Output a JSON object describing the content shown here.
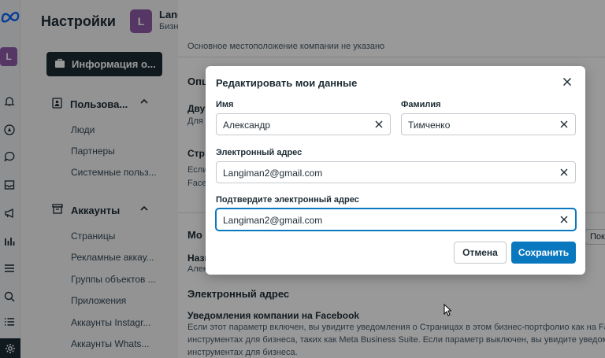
{
  "header": {
    "app_title": "Настройки",
    "business_initial": "L",
    "business_name": "Langust",
    "business_subtitle": "Бизнес-портфолио"
  },
  "rail": {
    "avatar_initial": "L",
    "icons": [
      "bell-icon",
      "compass-icon",
      "chat-icon",
      "inbox-icon",
      "megaphone-icon",
      "bar-chart-icon",
      "menu-icon",
      "search-icon",
      "list-icon",
      "gear-icon"
    ]
  },
  "sidebar": {
    "active_label": "Информация о...",
    "users_section": "Пользова...",
    "users_items": [
      "Люди",
      "Партнеры",
      "Системные польз..."
    ],
    "accounts_section": "Аккаунты",
    "accounts_items": [
      "Страницы",
      "Рекламные аккау...",
      "Группы объектов ...",
      "Приложения",
      "Аккаунты Instagr...",
      "Аккаунты Whats..."
    ]
  },
  "background": {
    "line1": "Основное местоположение компании не указано",
    "opt_heading": "Опц",
    "two_fa": "Дву",
    "for_label": "Для",
    "str": "Стр",
    "if_label": "Если",
    "face": "Face",
    "mo": "Мо",
    "name_label": "Назв",
    "alex": "Алек",
    "show_more": "Пока",
    "email_heading": "Электронный адрес",
    "notifications_heading": "Уведомления компании на Facebook",
    "notifications_line1": "Если этот параметр включен, вы увидите уведомления о Страницах в этом бизнес-портфолио как на Fa",
    "notifications_line2": "инструментах для бизнеса, таких как Meta Business Suite. Если параметр выключен, вы увидите уведом",
    "notifications_line3": "инструментах для бизнеса."
  },
  "modal": {
    "title": "Редактировать мои данные",
    "first_name_label": "Имя",
    "first_name_value": "Александр",
    "last_name_label": "Фамилия",
    "last_name_value": "Тимченко",
    "email_label": "Электронный адрес",
    "email_value": "Langiman2@gmail.com",
    "confirm_email_label": "Подтвердите электронный адрес",
    "confirm_email_value": "Langiman2@gmail.com",
    "cancel_label": "Отмена",
    "save_label": "Сохранить"
  },
  "colors": {
    "primary": "#0a78be",
    "dark": "#1c2b33",
    "avatar": "#8e5ba8"
  }
}
